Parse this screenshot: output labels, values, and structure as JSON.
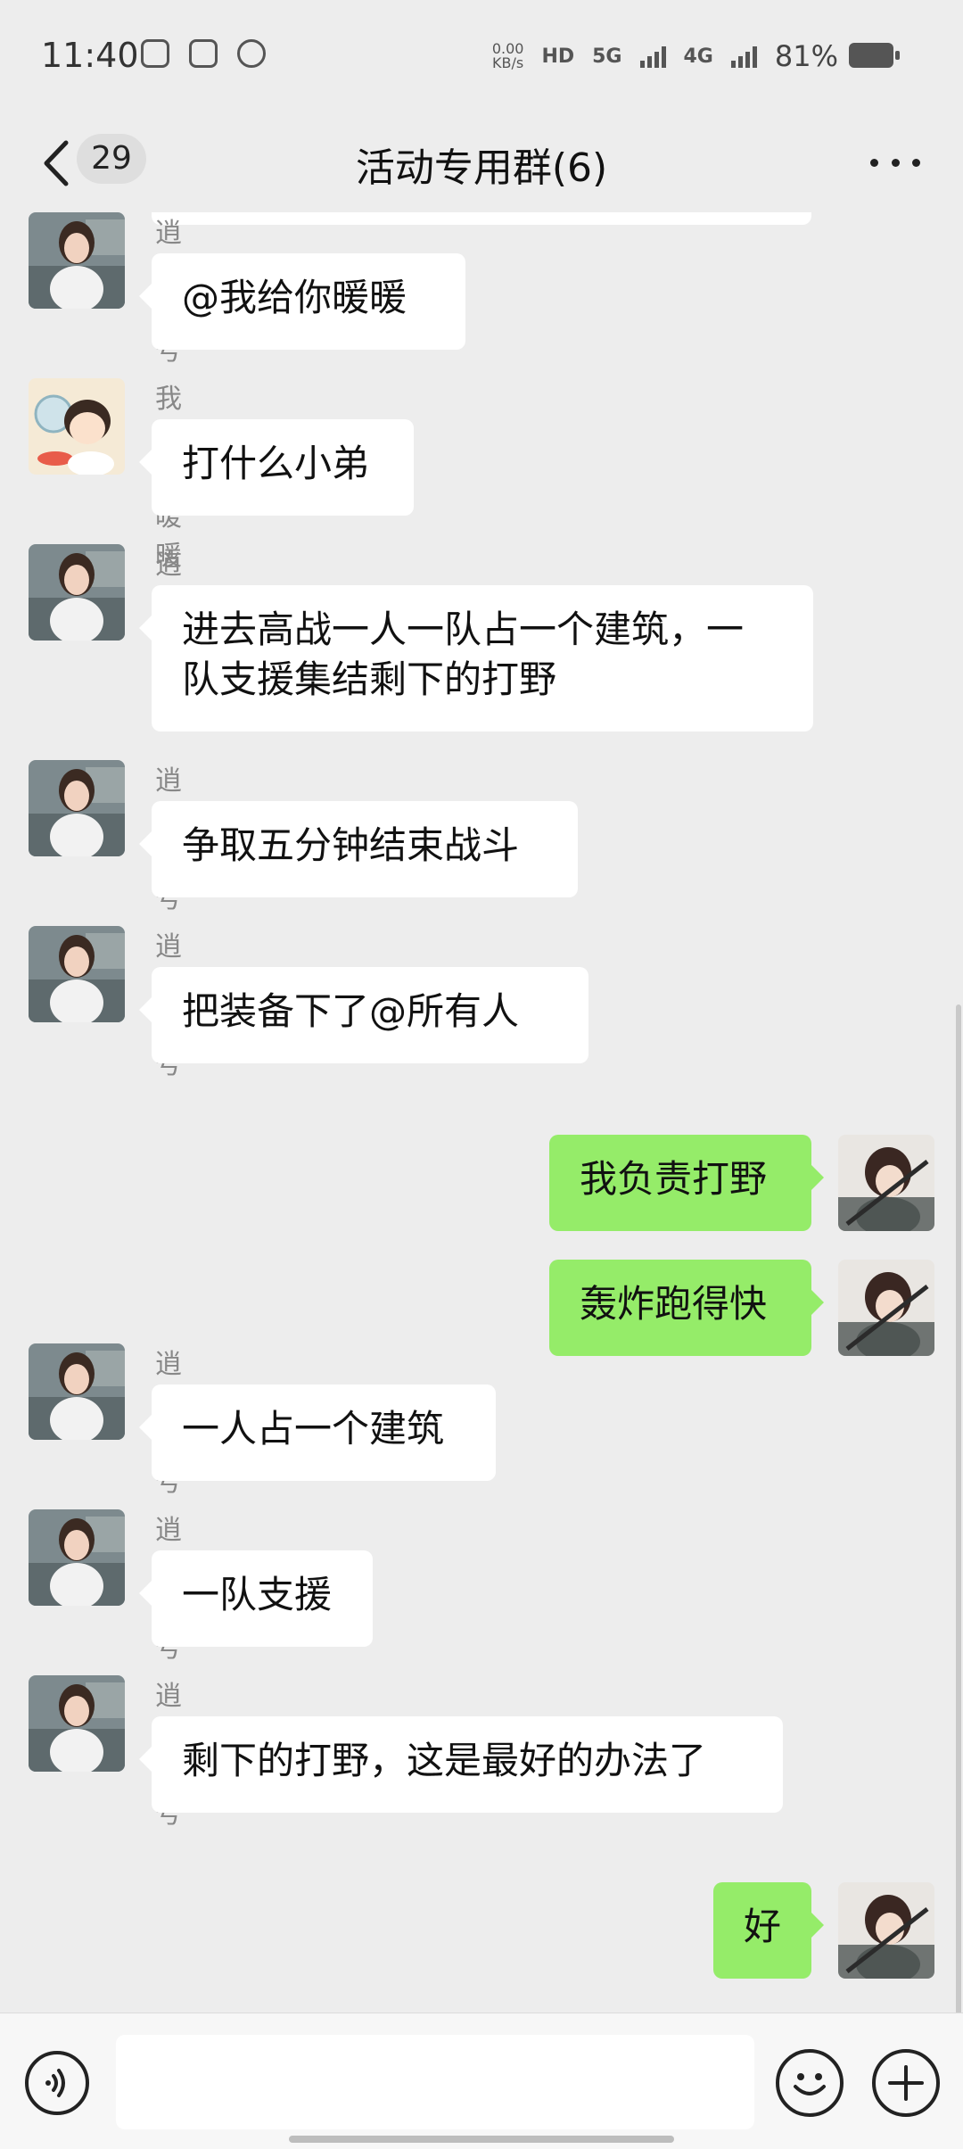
{
  "status_bar": {
    "time": "11:40",
    "net_speed_value": "0.00",
    "net_speed_unit": "KB/s",
    "hd_tag": "HD",
    "sim1_tag": "5G",
    "sim2_tag": "4G",
    "battery": "81%",
    "icons": [
      "game-controller-icon",
      "bird-icon",
      "gauge-icon",
      "hd-icon",
      "signal-icon",
      "battery-icon"
    ]
  },
  "header": {
    "unread_count": "29",
    "title": "活动专用群(6)"
  },
  "messages": [
    {
      "dir": "in",
      "avatar": "girl",
      "sender": "逍遥暗号",
      "text": "@我给你暖暖"
    },
    {
      "dir": "in",
      "avatar": "boy",
      "sender": "我给你暖暖",
      "text": "打什么小弟"
    },
    {
      "dir": "in",
      "avatar": "girl",
      "sender": "逍遥暗号",
      "text_lines": [
        "进去高战一人一队占一个建筑，一",
        "队支援集结剩下的打野"
      ]
    },
    {
      "dir": "in",
      "avatar": "girl",
      "sender": "逍遥暗号",
      "text": "争取五分钟结束战斗"
    },
    {
      "dir": "in",
      "avatar": "girl",
      "sender": "逍遥暗号",
      "text": "把装备下了@所有人"
    },
    {
      "dir": "out",
      "avatar": "me",
      "text": "我负责打野"
    },
    {
      "dir": "out",
      "avatar": "me",
      "text": "轰炸跑得快"
    },
    {
      "dir": "in",
      "avatar": "girl",
      "sender": "逍遥暗号",
      "text": "一人占一个建筑"
    },
    {
      "dir": "in",
      "avatar": "girl",
      "sender": "逍遥暗号",
      "text": "一队支援"
    },
    {
      "dir": "in",
      "avatar": "girl",
      "sender": "逍遥暗号",
      "text": "剩下的打野，这是最好的办法了"
    },
    {
      "dir": "out",
      "avatar": "me",
      "text": "好"
    }
  ],
  "input_bar": {
    "placeholder": "",
    "icons": [
      "voice-icon",
      "emoji-icon",
      "add-icon"
    ]
  },
  "colors": {
    "background": "#ededed",
    "bubble_in": "#ffffff",
    "bubble_out": "#95ec69"
  }
}
